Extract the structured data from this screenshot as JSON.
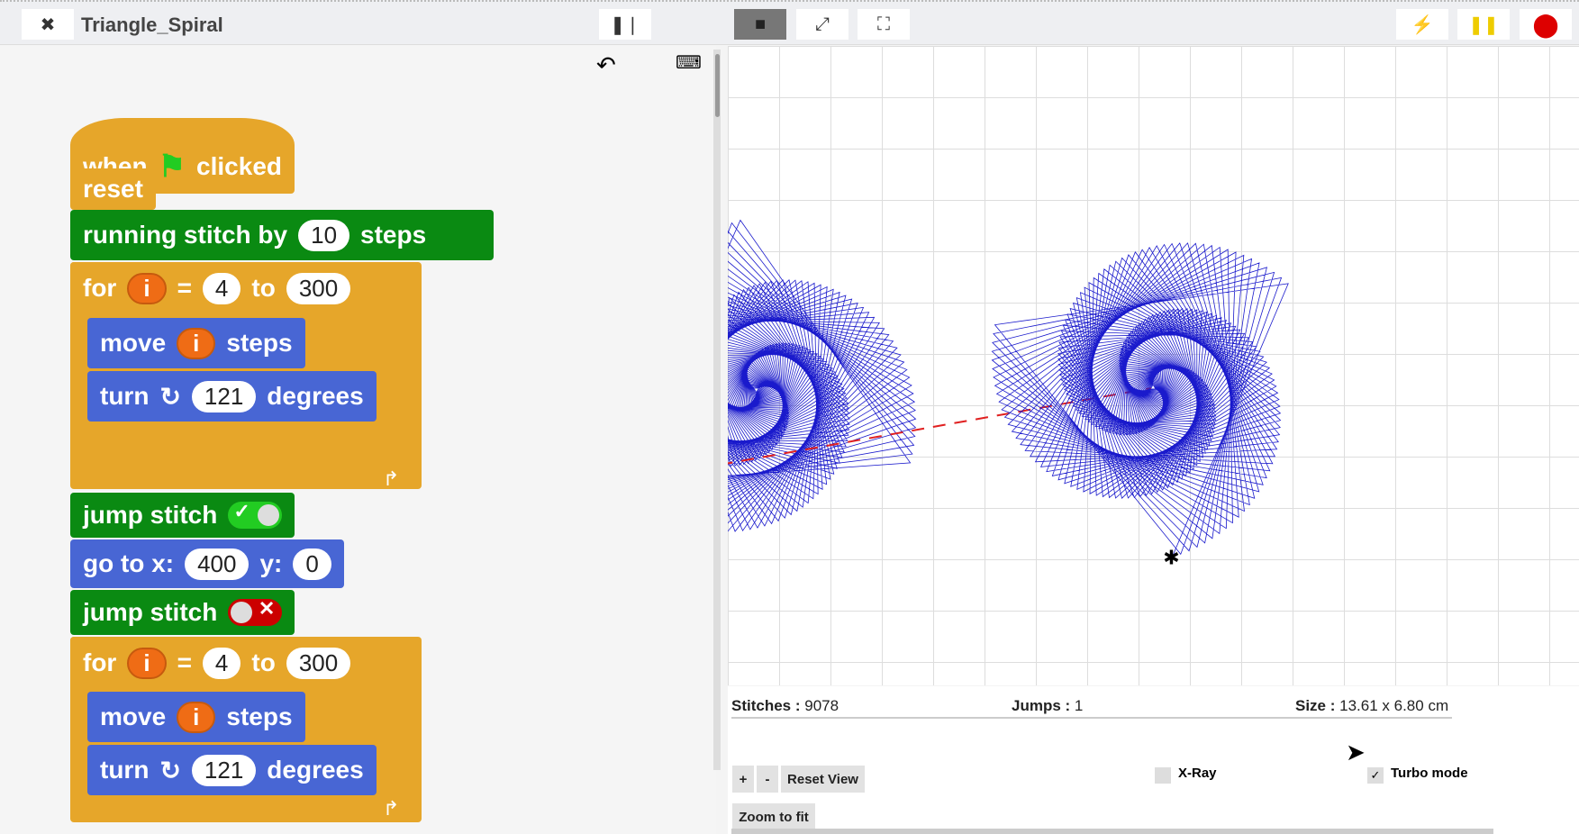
{
  "header": {
    "title": "Triangle_Spiral"
  },
  "icons": [
    "puzzle-icon",
    "footprints-icon",
    "stage-layout-icon",
    "expand-icon",
    "fullscreen-icon",
    "green-flag-icon",
    "pause-icon",
    "stop-icon",
    "undo-icon",
    "keyboard-icon",
    "turtle-icon"
  ],
  "colors": {
    "control": "#e6a62a",
    "embroidery": "#0a8a12",
    "motion": "#4866d4",
    "variable": "#ef6c15",
    "stitch": "#1a1acc",
    "jump": "#e02020"
  },
  "script": {
    "hat": {
      "when": "when",
      "clicked": "clicked"
    },
    "reset": "reset",
    "running": {
      "label": "running stitch by",
      "value": "10",
      "unit": "steps"
    },
    "loop1": {
      "for": "for",
      "var": "i",
      "eq": "=",
      "from": "4",
      "to_label": "to",
      "to": "300"
    },
    "move1": {
      "label": "move",
      "var": "i",
      "unit": "steps"
    },
    "turn1": {
      "label": "turn",
      "value": "121",
      "unit": "degrees"
    },
    "jump1": {
      "label": "jump stitch",
      "state": "on"
    },
    "goto": {
      "label": "go to x:",
      "x": "400",
      "ylabel": "y:",
      "y": "0"
    },
    "jump2": {
      "label": "jump stitch",
      "state": "off"
    },
    "loop2": {
      "for": "for",
      "var": "i",
      "eq": "=",
      "from": "4",
      "to_label": "to",
      "to": "300"
    },
    "move2": {
      "label": "move",
      "var": "i",
      "unit": "steps"
    },
    "turn2": {
      "label": "turn",
      "value": "121",
      "unit": "degrees"
    }
  },
  "stats": {
    "stitches_label": "Stitches :",
    "stitches": "9078",
    "jumps_label": "Jumps :",
    "jumps": "1",
    "size_label": "Size :",
    "size": "13.61 x 6.80 cm"
  },
  "controls": {
    "plus": "+",
    "minus": "-",
    "reset_view": "Reset View",
    "zoom_fit": "Zoom to fit",
    "xray": "X-Ray",
    "xray_checked": false,
    "turbo": "Turbo mode",
    "turbo_checked": true
  }
}
